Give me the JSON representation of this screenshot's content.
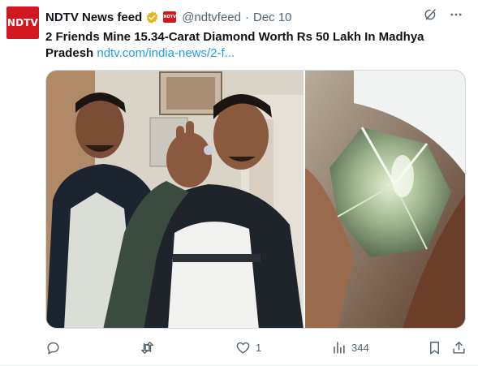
{
  "author": {
    "avatar_text": "NDTV",
    "display_name": "NDTV News feed",
    "affiliate_badge_text": "NDTV",
    "handle": "@ndtvfeed",
    "separator": "·",
    "timestamp": "Dec 10"
  },
  "tweet": {
    "headline": "2 Friends Mine 15.34-Carat Diamond Worth Rs 50 Lakh In Madhya Pradesh",
    "link_text": "ndtv.com/india-news/2-f..."
  },
  "media": {
    "photos": [
      "two-men-holding-diamond",
      "diamond-closeup"
    ]
  },
  "metrics": {
    "replies": "",
    "retweets": "",
    "likes": "1",
    "views": "344"
  },
  "colors": {
    "brand": "#d1181e",
    "link": "#1d9bf0",
    "muted": "#536471",
    "verified": "#e2b719"
  },
  "icons": [
    "verified-gold-icon",
    "grok-icon",
    "more-icon",
    "reply-icon",
    "retweet-icon",
    "like-icon",
    "views-icon",
    "bookmark-icon",
    "share-icon"
  ]
}
